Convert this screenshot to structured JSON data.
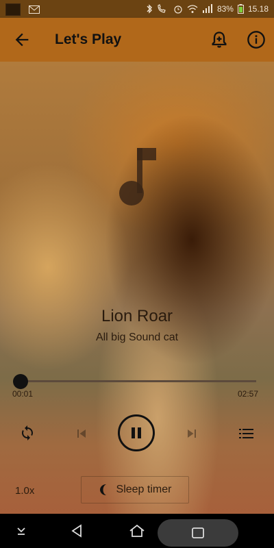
{
  "status_bar": {
    "battery": "83%",
    "time": "15.18"
  },
  "app_bar": {
    "title": "Let's Play"
  },
  "track": {
    "title": "Lion Roar",
    "artist": "All big Sound cat"
  },
  "player": {
    "elapsed": "00:01",
    "duration": "02:57",
    "progress_fraction": 0.006,
    "speed": "1.0x",
    "sleep_timer_label": "Sleep timer"
  },
  "icons": {
    "back": "arrow-back-icon",
    "alarm": "alarm-add-icon",
    "info": "info-icon",
    "note": "music-note-icon",
    "repeat": "repeat-icon",
    "previous": "skip-previous-icon",
    "pause": "pause-icon",
    "next": "skip-next-icon",
    "queue": "queue-list-icon",
    "moon": "moon-icon"
  },
  "colors": {
    "app_bar": "#b1681a",
    "status_bar": "#6b4312"
  }
}
